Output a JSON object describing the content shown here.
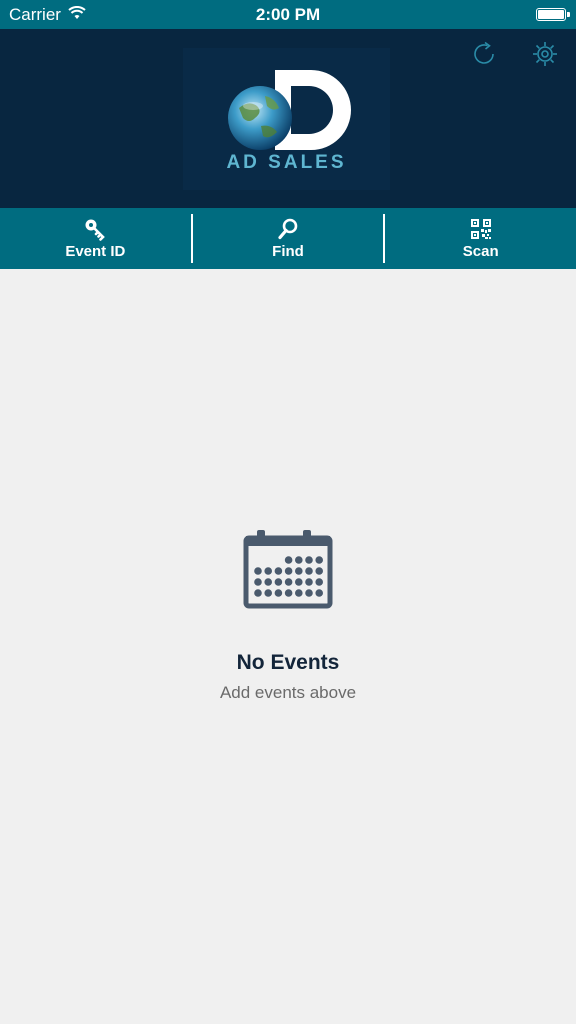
{
  "status_bar": {
    "carrier": "Carrier",
    "time": "2:00 PM"
  },
  "header": {
    "logo_text": "AD SALES",
    "refresh_icon": "refresh-icon",
    "settings_icon": "gear-icon"
  },
  "toolbar": {
    "items": [
      {
        "label": "Event ID",
        "icon": "key-icon"
      },
      {
        "label": "Find",
        "icon": "search-icon"
      },
      {
        "label": "Scan",
        "icon": "qr-code-icon"
      }
    ]
  },
  "empty_state": {
    "title": "No Events",
    "subtitle": "Add events above",
    "icon": "calendar-icon"
  },
  "colors": {
    "status_bar": "#006c80",
    "header_bg": "#082640",
    "toolbar_bg": "#006c80",
    "accent": "#5fb6d1",
    "body_bg": "#f0f0f0",
    "calendar": "#4a5a6d"
  }
}
